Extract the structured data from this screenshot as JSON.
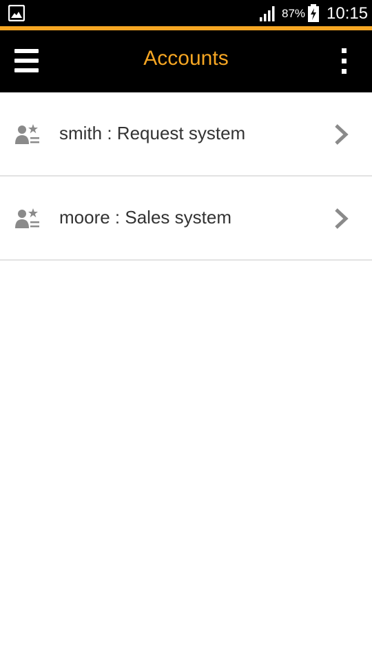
{
  "status_bar": {
    "battery_percent": "87%",
    "time": "10:15",
    "icons": [
      "gallery-icon",
      "signal-icon",
      "battery-charging-icon"
    ]
  },
  "app_bar": {
    "title": "Accounts",
    "menu_icon": "hamburger-menu-icon",
    "overflow_icon": "more-vertical-icon"
  },
  "accounts": [
    {
      "label": "smith : Request system",
      "icon": "account-star-icon",
      "action_icon": "chevron-right-icon"
    },
    {
      "label": "moore : Sales system",
      "icon": "account-star-icon",
      "action_icon": "chevron-right-icon"
    }
  ],
  "colors": {
    "accent": "#f6a623",
    "bar_background": "#000000",
    "icon_gray": "#8a8a8a",
    "divider": "#e2e2e2"
  }
}
